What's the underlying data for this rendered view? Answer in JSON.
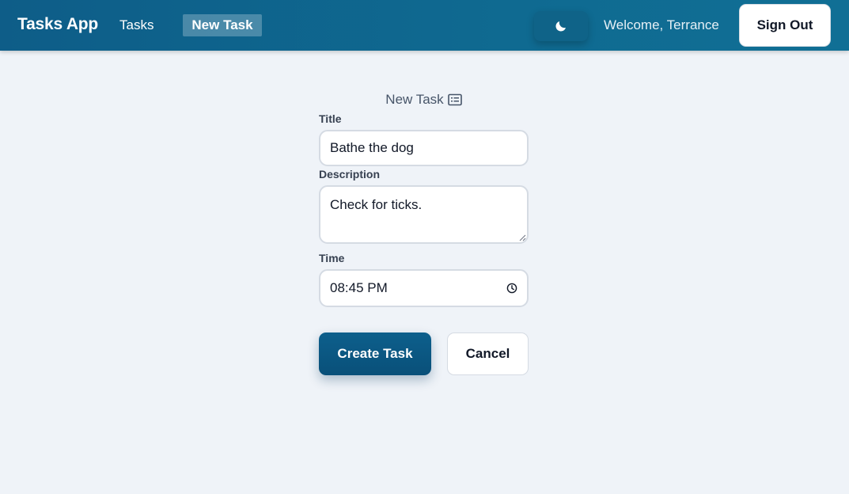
{
  "nav": {
    "brand": "Tasks App",
    "links": [
      {
        "label": "Tasks",
        "active": false
      },
      {
        "label": "New Task",
        "active": true
      }
    ],
    "welcome": "Welcome, Terrance",
    "signout_label": "Sign Out",
    "theme_icon": "moon-icon"
  },
  "form": {
    "heading": "New Task",
    "heading_icon": "list-icon",
    "fields": {
      "title": {
        "label": "Title",
        "value": "Bathe the dog"
      },
      "description": {
        "label": "Description",
        "value": "Check for ticks."
      },
      "time": {
        "label": "Time",
        "value": "08:45 PM",
        "icon": "clock-icon"
      }
    },
    "create_label": "Create Task",
    "cancel_label": "Cancel"
  },
  "colors": {
    "nav_bg": "#0e5d88",
    "page_bg": "#eff3f8",
    "primary": "#0b5883",
    "text_dark": "#111827"
  }
}
